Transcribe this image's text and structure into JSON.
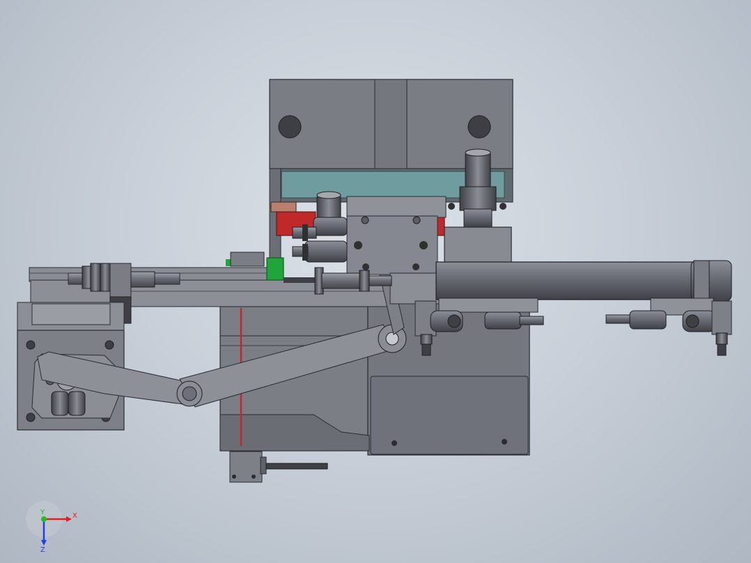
{
  "triad": {
    "x_label": "X",
    "y_label": "Y",
    "z_label": "Z",
    "x_color": "#e02020",
    "y_color": "#20c020",
    "z_color": "#2040e0"
  },
  "colors": {
    "steel": "#7d8087",
    "steel_dark": "#5f6269",
    "steel_light": "#9a9da4",
    "accent_red": "#c0282a",
    "accent_green": "#1fa53a",
    "teal_glass": "#6f9c9e",
    "brown_block": "#b87f6e"
  }
}
